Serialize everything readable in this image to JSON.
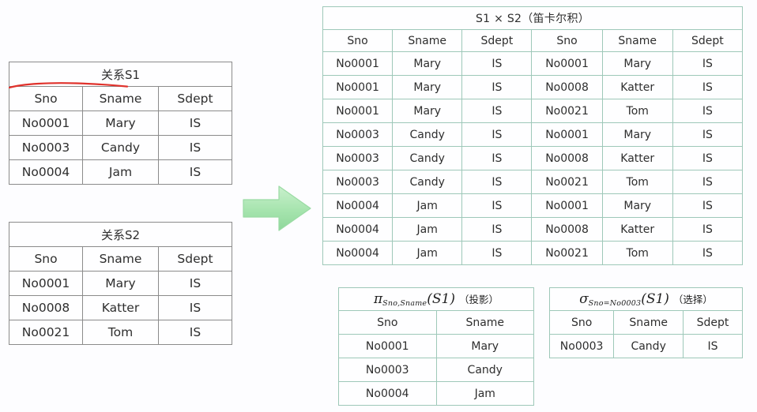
{
  "page": {
    "background": "#fdfdff",
    "gray_border": "#8b8b8b",
    "green_border": "#9ec8b9",
    "red_text": "#e8392f",
    "blue_text": "#3b4d9c",
    "arrow_fill": "#a8e6b0",
    "arrow_label": "flow-arrow-right"
  },
  "tables": {
    "s1": {
      "caption": "关系S1",
      "columns": [
        "Sno",
        "Sname",
        "Sdept"
      ],
      "rows": [
        [
          "No0001",
          "Mary",
          "IS"
        ],
        [
          "No0003",
          "Candy",
          "IS"
        ],
        [
          "No0004",
          "Jam",
          "IS"
        ]
      ]
    },
    "s2": {
      "caption": "关系S2",
      "columns": [
        "Sno",
        "Sname",
        "Sdept"
      ],
      "rows": [
        [
          "No0001",
          "Mary",
          "IS"
        ],
        [
          "No0008",
          "Katter",
          "IS"
        ],
        [
          "No0021",
          "Tom",
          "IS"
        ]
      ]
    },
    "cartesian": {
      "caption": "S1 × S2（笛卡尔积）",
      "columns": [
        "Sno",
        "Sname",
        "Sdept",
        "Sno",
        "Sname",
        "Sdept"
      ],
      "rows": [
        {
          "left": [
            "No0001",
            "Mary",
            "IS"
          ],
          "right": [
            "No0001",
            "Mary",
            "IS"
          ],
          "right_color": "red"
        },
        {
          "left": [
            "No0001",
            "Mary",
            "IS"
          ],
          "right": [
            "No0008",
            "Katter",
            "IS"
          ],
          "right_color": "red"
        },
        {
          "left": [
            "No0001",
            "Mary",
            "IS"
          ],
          "right": [
            "No0021",
            "Tom",
            "IS"
          ],
          "right_color": "red"
        },
        {
          "left": [
            "No0003",
            "Candy",
            "IS"
          ],
          "right": [
            "No0001",
            "Mary",
            "IS"
          ],
          "right_color": "black"
        },
        {
          "left": [
            "No0003",
            "Candy",
            "IS"
          ],
          "right": [
            "No0008",
            "Katter",
            "IS"
          ],
          "right_color": "black"
        },
        {
          "left": [
            "No0003",
            "Candy",
            "IS"
          ],
          "right": [
            "No0021",
            "Tom",
            "IS"
          ],
          "right_color": "black"
        },
        {
          "left": [
            "No0004",
            "Jam",
            "IS"
          ],
          "right": [
            "No0001",
            "Mary",
            "IS"
          ],
          "right_color": "blue"
        },
        {
          "left": [
            "No0004",
            "Jam",
            "IS"
          ],
          "right": [
            "No0008",
            "Katter",
            "IS"
          ],
          "right_color": "blue"
        },
        {
          "left": [
            "No0004",
            "Jam",
            "IS"
          ],
          "right": [
            "No0021",
            "Tom",
            "IS"
          ],
          "right_color": "blue"
        }
      ]
    },
    "projection": {
      "formula": {
        "operator": "π",
        "subscript": "Sno,Sname",
        "argument": "(S1)",
        "note": "（投影）"
      },
      "columns": [
        "Sno",
        "Sname"
      ],
      "rows": [
        [
          "No0001",
          "Mary"
        ],
        [
          "No0003",
          "Candy"
        ],
        [
          "No0004",
          "Jam"
        ]
      ]
    },
    "selection": {
      "formula": {
        "operator": "σ",
        "subscript": "Sno=No0003",
        "argument": "(S1)",
        "note": "（选择）"
      },
      "columns": [
        "Sno",
        "Sname",
        "Sdept"
      ],
      "rows": [
        [
          "No0003",
          "Candy",
          "IS"
        ]
      ]
    }
  }
}
